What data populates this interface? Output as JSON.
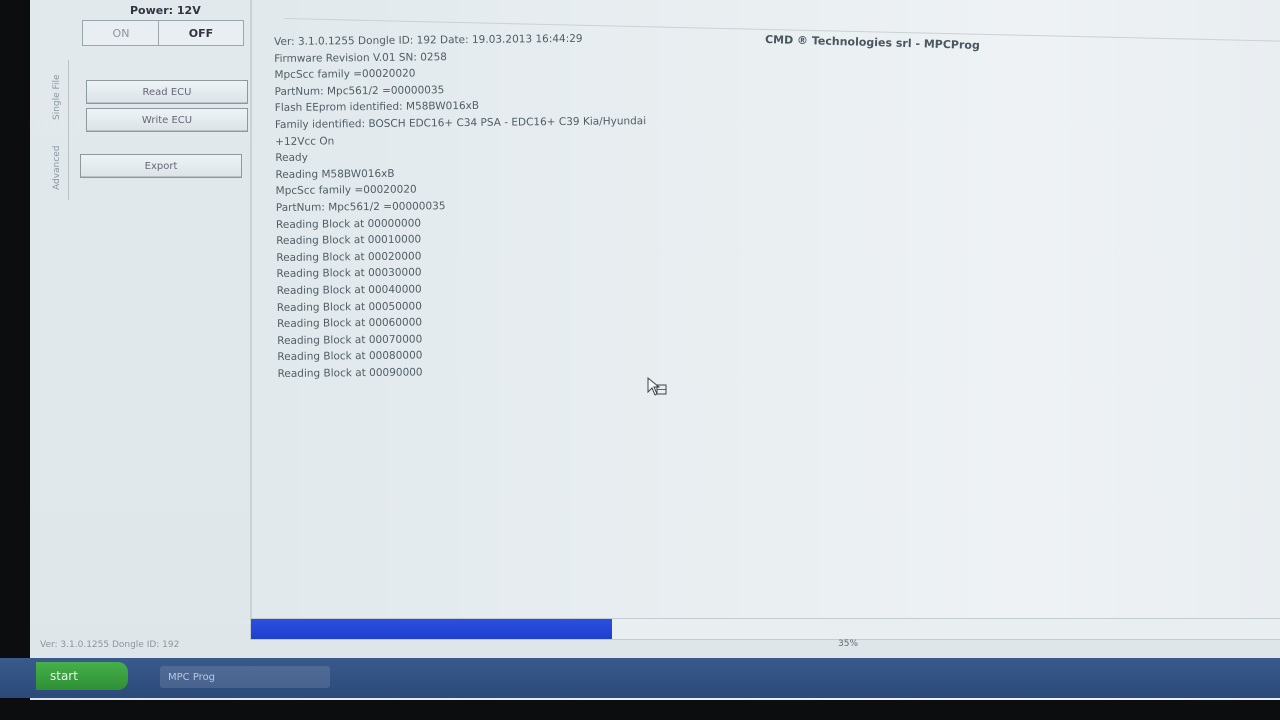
{
  "header": {
    "power_label": "Power: 12V",
    "on_label": "ON",
    "off_label": "OFF",
    "app_title": "CMD ® Technologies srl - MPCProg"
  },
  "side_tabs": [
    "Single File",
    "Advanced"
  ],
  "actions": {
    "read_label": "Read ECU",
    "write_label": "Write ECU",
    "export_label": "Export"
  },
  "log": [
    "Ver: 3.1.0.1255    Dongle ID: 192    Date: 19.03.2013 16:44:29",
    "Firmware Revision V.01   SN: 0258",
    "MpcScc family  =00020020",
    "PartNum: Mpc561/2   =00000035",
    "Flash EEprom identified: M58BW016xB",
    "Family identified: BOSCH EDC16+ C34 PSA - EDC16+ C39 Kia/Hyundai",
    "+12Vcc On",
    "Ready",
    "Reading M58BW016xB",
    "MpcScc family  =00020020",
    "PartNum: Mpc561/2   =00000035",
    "Reading Block at 00000000",
    "Reading Block at 00010000",
    "Reading Block at 00020000",
    "Reading Block at 00030000",
    "Reading Block at 00040000",
    "Reading Block at 00050000",
    "Reading Block at 00060000",
    "Reading Block at 00070000",
    "Reading Block at 00080000",
    "Reading Block at 00090000"
  ],
  "status": {
    "version_text": "Ver: 3.1.0.1255    Dongle ID: 192",
    "progress_text": "35%",
    "progress_value": 0.35
  },
  "taskbar": {
    "start_label": "start",
    "task_label": "MPC Prog"
  },
  "colors": {
    "progress": "#2d4fe0",
    "taskbar": "#2b4a7a",
    "start": "#3a9f3f"
  },
  "icons": {
    "cursor": "mouse-pointer-icon"
  }
}
